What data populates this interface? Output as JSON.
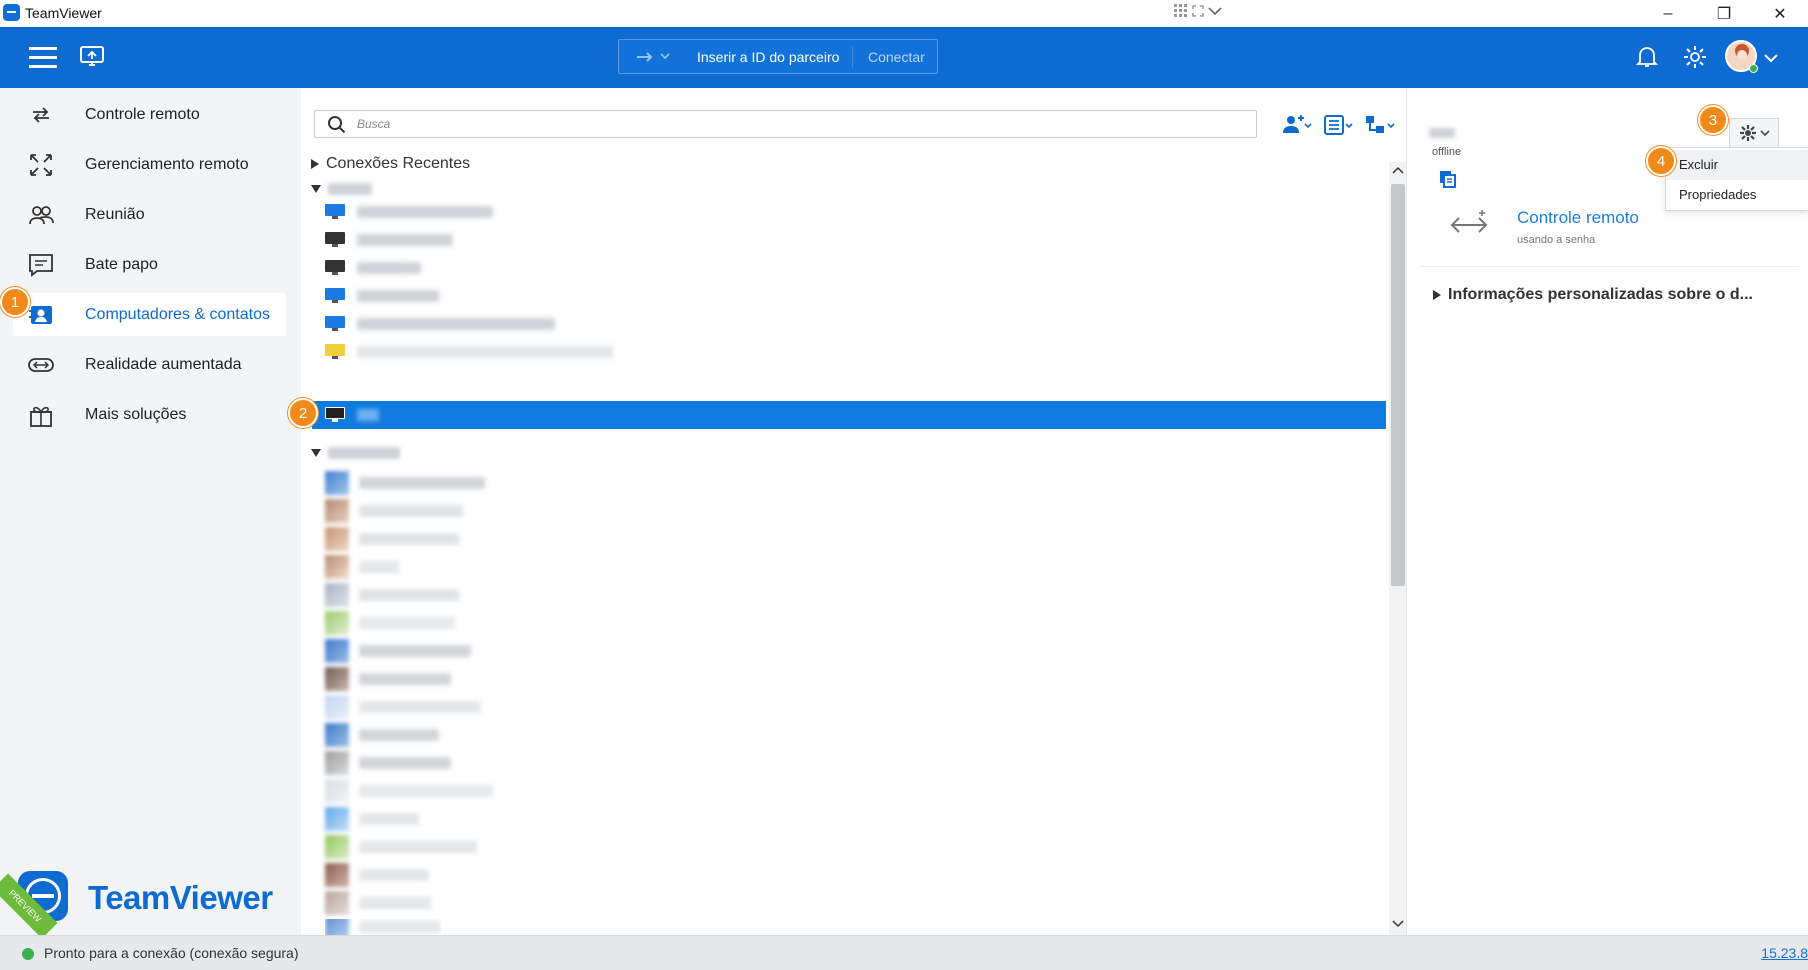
{
  "window": {
    "title": "TeamViewer",
    "minimize": "–",
    "restore": "❐",
    "close": "✕"
  },
  "topbar": {
    "partner_placeholder": "Inserir a ID do parceiro",
    "connect_label": "Conectar"
  },
  "sidebar": {
    "items": [
      {
        "label": "Controle remoto",
        "icon": "remote-control-icon"
      },
      {
        "label": "Gerenciamento remoto",
        "icon": "remote-management-icon"
      },
      {
        "label": "Reunião",
        "icon": "meeting-icon"
      },
      {
        "label": "Bate papo",
        "icon": "chat-icon"
      },
      {
        "label": "Computadores & contatos",
        "icon": "contacts-icon",
        "active": true
      },
      {
        "label": "Realidade aumentada",
        "icon": "ar-icon"
      },
      {
        "label": "Mais soluções",
        "icon": "gift-icon"
      }
    ],
    "brand": "TeamViewer",
    "preview": "PREVIEW"
  },
  "list": {
    "search_placeholder": "Busca",
    "recent_group": "Conexões Recentes"
  },
  "details": {
    "status": "offline",
    "gear_menu": [
      "Excluir",
      "Propriedades"
    ],
    "action_title": "Controle remoto",
    "action_sub": "usando a senha",
    "info_section": "Informações personalizadas sobre o d..."
  },
  "statusbar": {
    "text": "Pronto para a conexão (conexão segura)",
    "version": "15.23.8"
  },
  "badges": [
    "1",
    "2",
    "3",
    "4"
  ],
  "colors": {
    "brand_blue": "#0e6bd1",
    "selection": "#0f7be0",
    "badge": "#f28a1a",
    "online": "#3fae4f"
  }
}
